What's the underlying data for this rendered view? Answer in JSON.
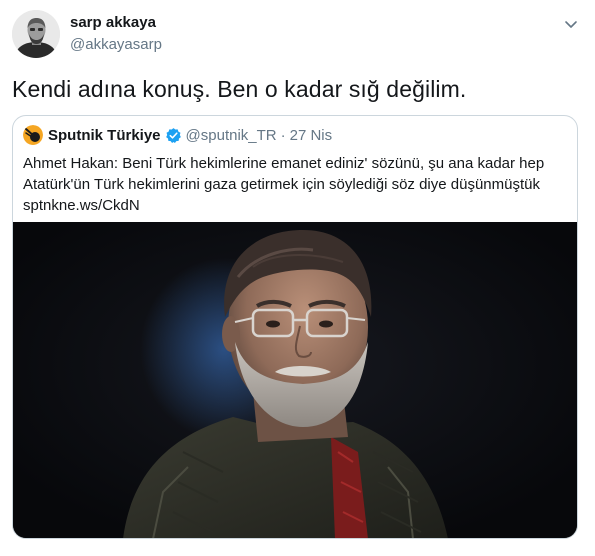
{
  "tweet": {
    "author_name": "sarp akkaya",
    "author_handle": "@akkayasarp",
    "text": "Kendi adına konuş. Ben o kadar sığ değilim.",
    "avatar_icon": "user-avatar",
    "menu_icon": "chevron-down-icon"
  },
  "quoted_tweet": {
    "author_name": "Sputnik Türkiye",
    "author_handle": "@sputnik_TR",
    "separator": "·",
    "date": "27 Nis",
    "verified": true,
    "text_lines": [
      "Ahmet Hakan: Beni Türk hekimlerine emanet ediniz' sözünü, şu ana kadar hep",
      "Atatürk'ün Türk hekimlerini gaza getirmek için söylediği söz diye düşünmüştük",
      "sptnkne.ws/CkdN"
    ],
    "image": "portrait-photo"
  },
  "colors": {
    "text_primary": "#14171a",
    "text_secondary": "#657786",
    "border": "#ccd6dd",
    "verified_blue": "#1da1f2",
    "sputnik_orange": "#f5a623",
    "photo_background": "#0a0b0f"
  }
}
